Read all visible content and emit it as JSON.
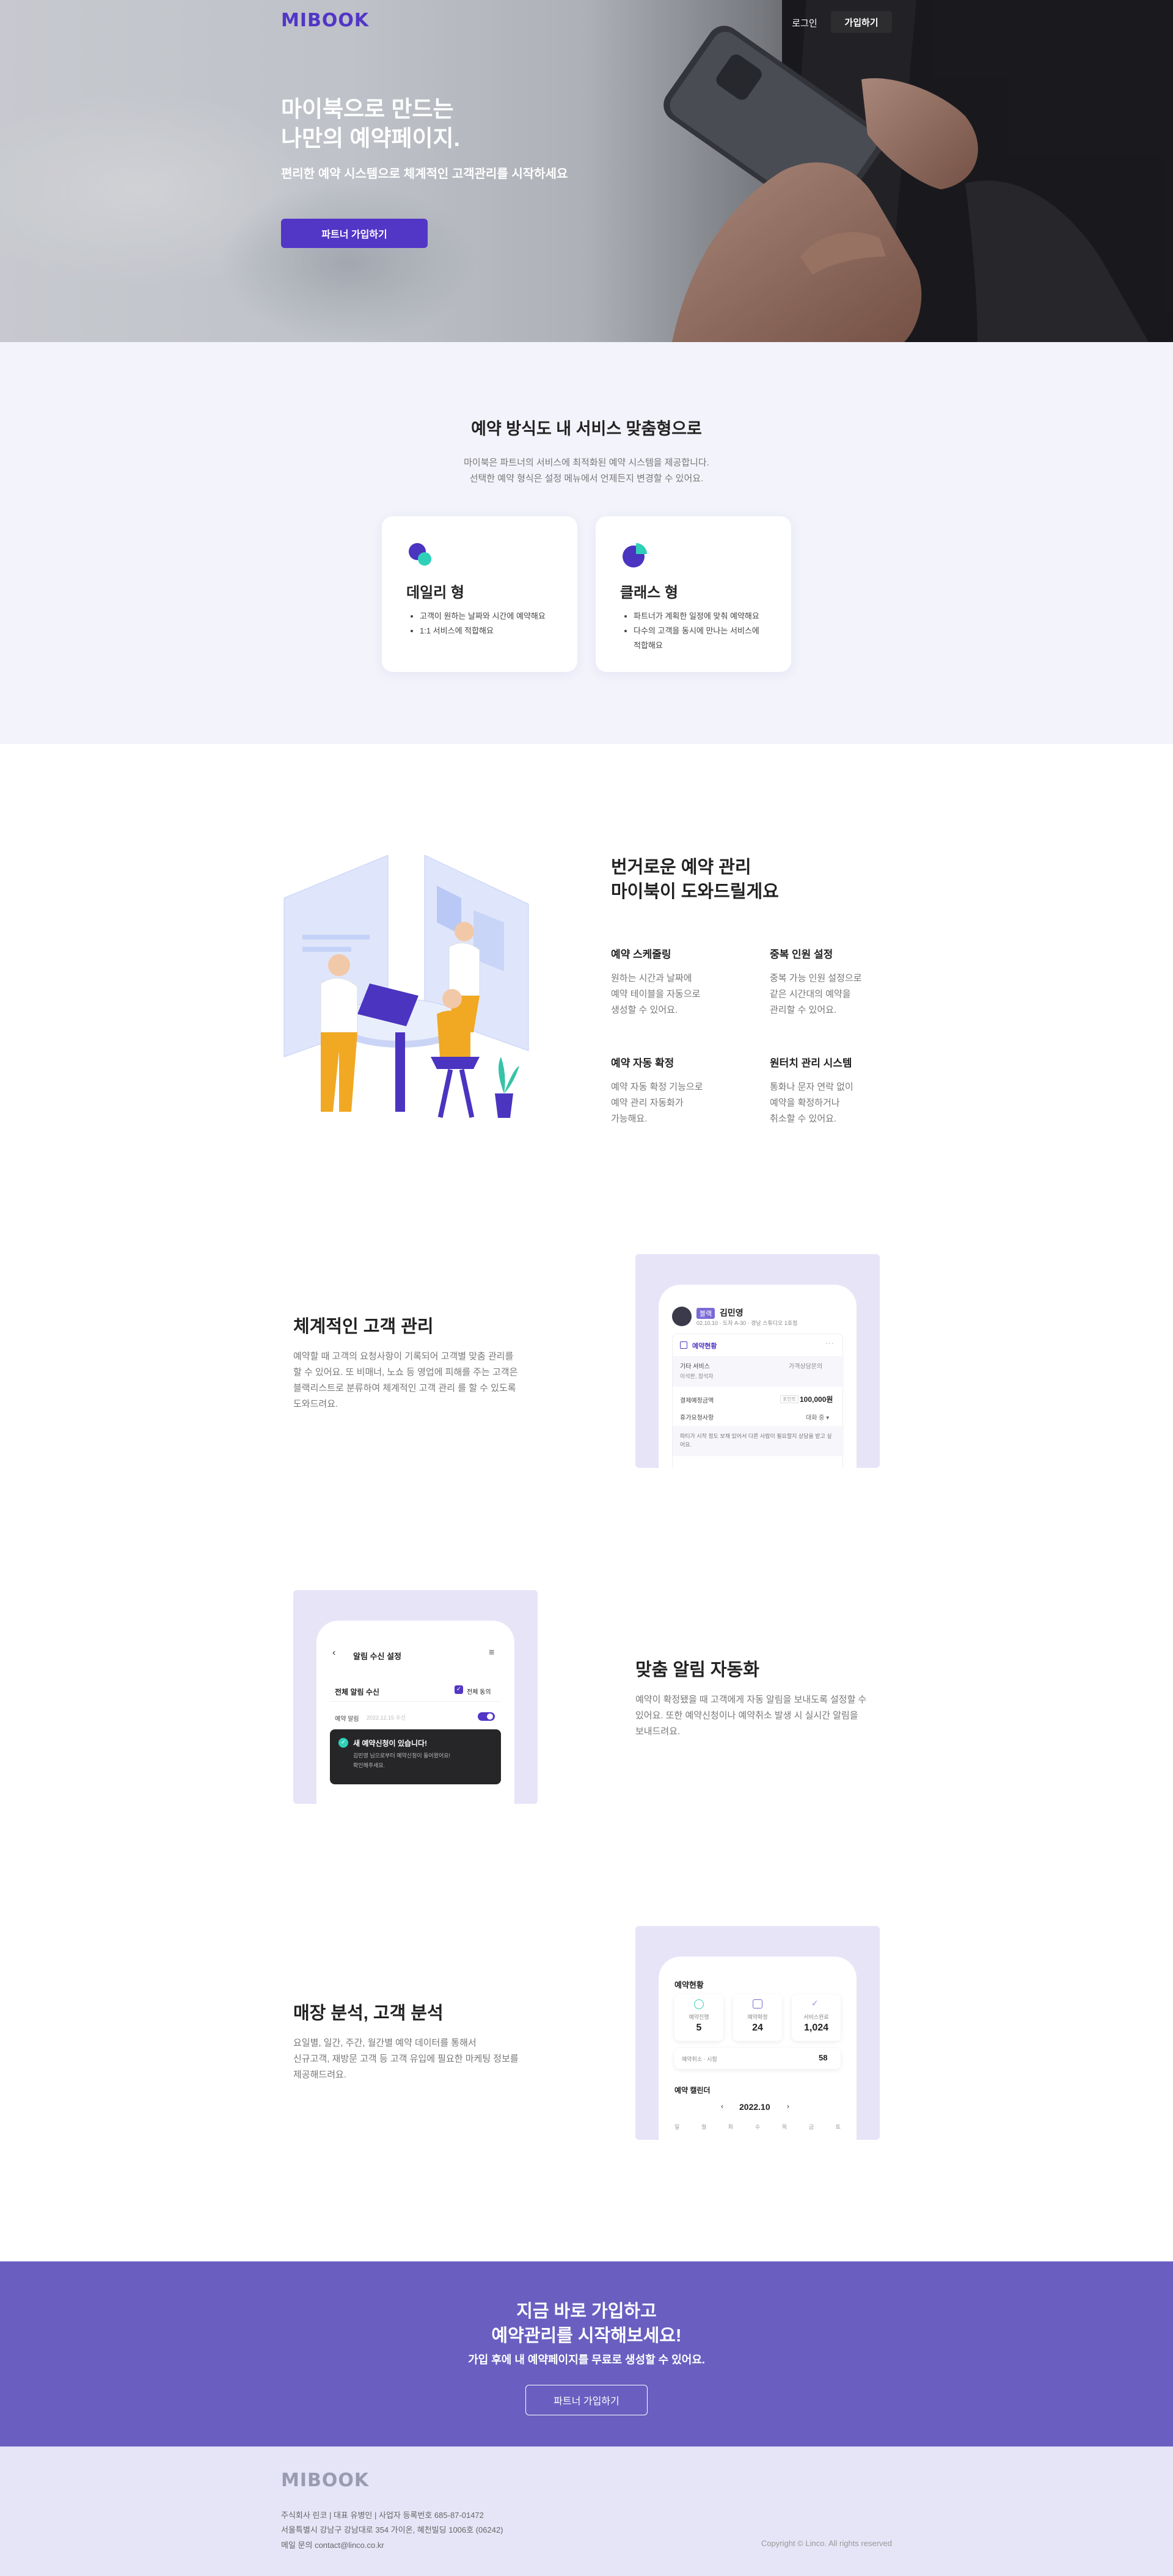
{
  "brand": {
    "logo": "MIBOOK",
    "color": "#5236c6"
  },
  "header": {
    "login": "로그인",
    "join": "가입하기"
  },
  "hero": {
    "title_line1": "마이북으로 만드는",
    "title_line2": "나만의 예약페이지.",
    "subtitle": "편리한 예약 시스템으로 체계적인 고객관리를 시작하세요",
    "button": "파트너 가입하기"
  },
  "service": {
    "title": "예약 방식도 내 서비스 맞춤형으로",
    "desc_line1": "마이북은 파트너의 서비스에 최적화된 예약 시스템을 제공합니다.",
    "desc_line2": "선택한 예약 형식은 설정 메뉴에서 언제든지 변경할 수 있어요.",
    "cards": [
      {
        "icon": "chat-bubbles-icon",
        "title": "데일리 형",
        "items": [
          "고객이 원하는 날짜와 시간에 예약해요",
          "1:1 서비스에 적합해요"
        ]
      },
      {
        "icon": "pie-chart-icon",
        "title": "클래스 형",
        "items": [
          "파트너가 계획한 일정에 맞춰 예약해요",
          "다수의 고객을 동시에 만나는 서비스에 적합해요"
        ]
      }
    ]
  },
  "features": {
    "title_line1": "번거로운 예약 관리",
    "title_line2": "마이북이 도와드릴게요",
    "items": [
      {
        "title": "예약 스케줄링",
        "lines": [
          "원하는 시간과 날짜에",
          "예약 테이블을 자동으로",
          "생성할 수 있어요."
        ]
      },
      {
        "title": "중복 인원 설정",
        "lines": [
          "중복 가능 인원 설정으로",
          "같은 시간대의 예약을",
          "관리할 수 있어요."
        ]
      },
      {
        "title": "예약 자동 확정",
        "lines": [
          "예약 자동 확정 기능으로",
          "예약 관리 자동화가",
          "가능해요."
        ]
      },
      {
        "title": "원터치 관리 시스템",
        "lines": [
          "통화나 문자 연락 없이",
          "예약을 확정하거나",
          "취소할 수 있어요."
        ]
      }
    ]
  },
  "customer": {
    "title": "체계적인 고객 관리",
    "lines": [
      "예약할 때 고객의 요청사항이 기록되어 고객별 맞춤 관리를",
      "할 수 있어요. 또 비매너, 노쇼 등 영업에 피해를 주는 고객은",
      "블랙리스트로 분류하여 체계적인 고객 관리 를 할 수 있도록",
      "도와드려요."
    ],
    "mock": {
      "badge": "블랙",
      "name": "김민영",
      "info": "02.10.10 · 도자 A-30 · 경남 스튜디오 1호점",
      "section": "예약현황",
      "service_label": "기타 서비스",
      "service_value": "가격상담문의",
      "sub_label": "이석판, 참석자",
      "price_label": "결제예정금액",
      "price_tag": "포인트",
      "price": "100,000원",
      "status_label": "휴가요청사항",
      "status_value": "대화 중 ▾",
      "note": "파티가 시작 정도 보채 있어서 다른 사람이 필요할지 상담을 받고 싶어요."
    }
  },
  "alarm": {
    "title": "맞춤 알림 자동화",
    "lines": [
      "예약이 확정됐을 때 고객에게 자동 알림을 보내도록 설정할 수",
      "있어요. 또한 예약신청이나 예약취소 발생 시 실시간 알림을",
      "보내드려요."
    ],
    "mock": {
      "header": "알림 수신 설정",
      "all_label": "전체 알림 수신",
      "all_check": "전체 동의",
      "row_label": "예약 알림",
      "row_time": "2022.12.15 수신",
      "toast_title": "새 예약신청이 있습니다!",
      "toast_line1": "김민영 님으로부터 예약신청이 들어왔어요!",
      "toast_line2": "확인해주세요."
    }
  },
  "analytics": {
    "title": "매장 분석, 고객 분석",
    "lines": [
      "요일별, 일간, 주간, 월간별 예약 데이터를 통해서",
      "신규고객, 재방문 고객 등 고객 유입에 필요한 마케팅 정보를",
      "제공해드려요."
    ],
    "mock": {
      "status_title": "예약현황",
      "stats": [
        {
          "icon": "check-circle-icon",
          "label": "예약진행",
          "value": "5"
        },
        {
          "icon": "calendar-icon",
          "label": "예약확정",
          "value": "24"
        },
        {
          "icon": "checkmark-icon",
          "label": "서비스완료",
          "value": "1,024"
        }
      ],
      "total_label": "예약취소 · 시험",
      "total_value": "58",
      "calendar_title": "예약 캘린더",
      "month": "2022.10",
      "weekdays": [
        "일",
        "월",
        "화",
        "수",
        "목",
        "금",
        "토"
      ]
    }
  },
  "cta": {
    "title_line1": "지금 바로 가입하고",
    "title_line2": "예약관리를 시작해보세요!",
    "subtitle": "가입 후에 내 예약페이지를 무료로 생성할 수 있어요.",
    "button": "파트너 가입하기"
  },
  "footer": {
    "logo": "MIBOOK",
    "line1": "주식회사 린코 | 대표 유병인 | 사업자 등록번호 685-87-01472",
    "line2": "서울특별시 강남구 강남대로 354 가이온, 혜천빌딩 1006호 (06242)",
    "line3": "메일 문의 contact@linco.co.kr",
    "copyright": "Copyright © Linco. All rights reserved"
  }
}
